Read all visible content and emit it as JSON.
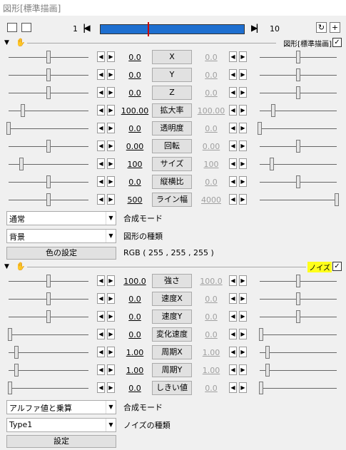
{
  "window": {
    "title": "図形[標準描画]"
  },
  "toolbar": {
    "frame_start": "1",
    "frame_end": "10",
    "prev_symbol": "|◀",
    "next_symbol": "▶|",
    "icons": [
      "camera-icon",
      "layer-icon",
      "refresh-icon",
      "add-icon"
    ]
  },
  "filters": {
    "standard": {
      "title": "図形[標準描画]",
      "checked": true,
      "rows": [
        {
          "name": "X",
          "left": "0.0",
          "right": "0.0",
          "left_pos": 0.5,
          "right_pos": 0.5
        },
        {
          "name": "Y",
          "left": "0.0",
          "right": "0.0",
          "left_pos": 0.5,
          "right_pos": 0.5
        },
        {
          "name": "Z",
          "left": "0.0",
          "right": "0.0",
          "left_pos": 0.5,
          "right_pos": 0.5
        },
        {
          "name": "拡大率",
          "left": "100.00",
          "right": "100.00",
          "left_pos": 0.18,
          "right_pos": 0.18
        },
        {
          "name": "透明度",
          "left": "0.0",
          "right": "0.0",
          "left_pos": 0.0,
          "right_pos": 0.0
        },
        {
          "name": "回転",
          "left": "0.00",
          "right": "0.00",
          "left_pos": 0.5,
          "right_pos": 0.5
        },
        {
          "name": "サイズ",
          "left": "100",
          "right": "100",
          "left_pos": 0.16,
          "right_pos": 0.16
        },
        {
          "name": "縦横比",
          "left": "0.0",
          "right": "0.0",
          "left_pos": 0.5,
          "right_pos": 0.5
        },
        {
          "name": "ライン幅",
          "left": "500",
          "right": "4000",
          "left_pos": 0.5,
          "right_pos": 1.0
        }
      ],
      "blend_value": "通常",
      "blend_label": "合成モード",
      "shape_value": "背景",
      "shape_label": "図形の種類",
      "color_button": "色の設定",
      "rgb": "RGB ( 255 , 255 , 255 )"
    },
    "noise": {
      "title": "ノイズ",
      "checked": true,
      "rows": [
        {
          "name": "強さ",
          "left": "100.0",
          "right": "100.0",
          "left_pos": 0.5,
          "right_pos": 0.5
        },
        {
          "name": "速度X",
          "left": "0.0",
          "right": "0.0",
          "left_pos": 0.5,
          "right_pos": 0.5
        },
        {
          "name": "速度Y",
          "left": "0.0",
          "right": "0.0",
          "left_pos": 0.5,
          "right_pos": 0.5
        },
        {
          "name": "変化速度",
          "left": "0.0",
          "right": "0.0",
          "left_pos": 0.02,
          "right_pos": 0.02
        },
        {
          "name": "周期X",
          "left": "1.00",
          "right": "1.00",
          "left_pos": 0.1,
          "right_pos": 0.1
        },
        {
          "name": "周期Y",
          "left": "1.00",
          "right": "1.00",
          "left_pos": 0.1,
          "right_pos": 0.1
        },
        {
          "name": "しきい値",
          "left": "0.0",
          "right": "0.0",
          "left_pos": 0.02,
          "right_pos": 0.02
        }
      ],
      "blend_value": "アルファ値と乗算",
      "blend_label": "合成モード",
      "type_value": "Type1",
      "type_label": "ノイズの種類",
      "settings_button": "設定"
    }
  },
  "colors": {
    "timeline": "#1e6fd0",
    "highlight": "#ffff1a",
    "cursor": "#cc0000"
  }
}
